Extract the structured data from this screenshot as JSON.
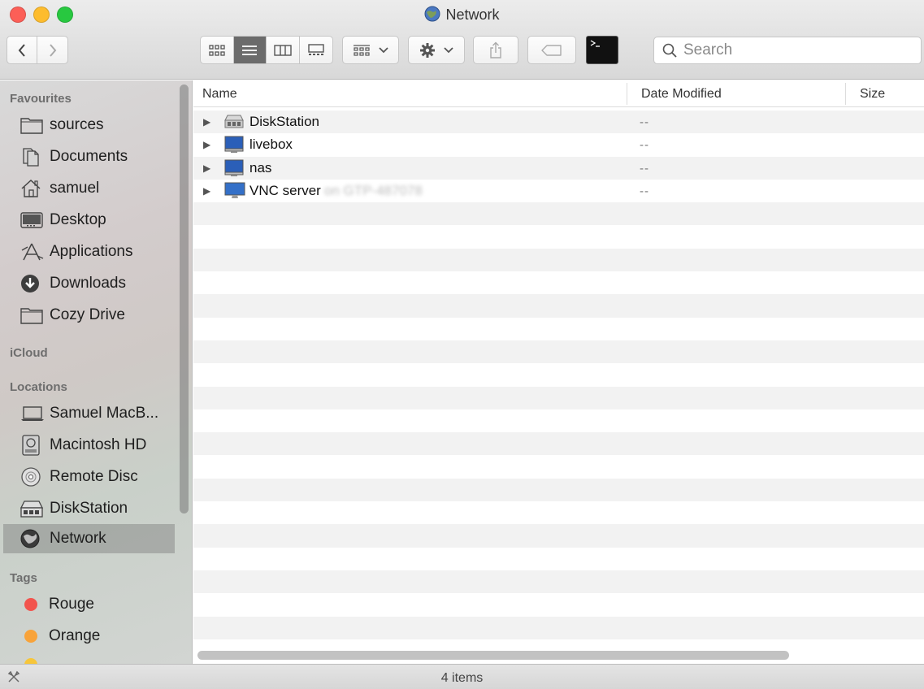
{
  "window": {
    "title": "Network"
  },
  "toolbar": {
    "search_placeholder": "Search"
  },
  "sidebar": {
    "favourites_heading": "Favourites",
    "favourites": [
      {
        "label": "sources",
        "icon": "folder-icon"
      },
      {
        "label": "Documents",
        "icon": "documents-icon"
      },
      {
        "label": "samuel",
        "icon": "home-icon"
      },
      {
        "label": "Desktop",
        "icon": "desktop-icon"
      },
      {
        "label": "Applications",
        "icon": "applications-icon"
      },
      {
        "label": "Downloads",
        "icon": "downloads-icon"
      },
      {
        "label": "Cozy Drive",
        "icon": "folder-icon"
      }
    ],
    "icloud_heading": "iCloud",
    "locations_heading": "Locations",
    "locations": [
      {
        "label": "Samuel MacB...",
        "icon": "laptop-icon"
      },
      {
        "label": "Macintosh HD",
        "icon": "hard-drive-icon"
      },
      {
        "label": "Remote Disc",
        "icon": "disc-icon"
      },
      {
        "label": "DiskStation",
        "icon": "server-icon"
      },
      {
        "label": "Network",
        "icon": "network-globe-icon",
        "selected": true
      }
    ],
    "tags_heading": "Tags",
    "tags": [
      {
        "label": "Rouge",
        "color": "#f2544d"
      },
      {
        "label": "Orange",
        "color": "#f8a33a"
      }
    ]
  },
  "list": {
    "columns": {
      "name": "Name",
      "date": "Date Modified",
      "size": "Size"
    },
    "rows": [
      {
        "name": "DiskStation",
        "date": "--",
        "icon": "server-icon"
      },
      {
        "name": "livebox",
        "date": "--",
        "icon": "monitor-icon"
      },
      {
        "name": "nas",
        "date": "--",
        "icon": "monitor-icon"
      },
      {
        "name": "VNC server",
        "name_suffix": "on GTP-487078",
        "date": "--",
        "icon": "imac-icon"
      }
    ]
  },
  "status": {
    "count": "4 items"
  }
}
